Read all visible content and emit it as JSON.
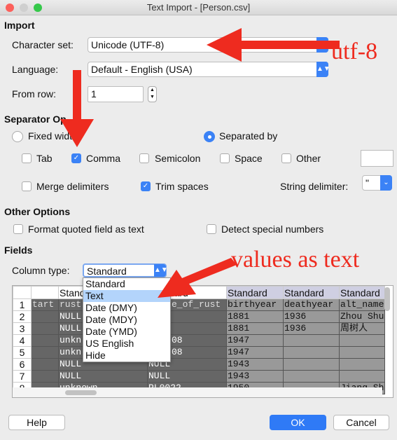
{
  "window": {
    "title": "Text Import - [Person.csv]"
  },
  "import": {
    "heading": "Import",
    "charset_label": "Character set:",
    "charset_value": "Unicode (UTF-8)",
    "language_label": "Language:",
    "language_value": "Default - English (USA)",
    "from_row_label": "From row:",
    "from_row_value": "1"
  },
  "separator": {
    "heading": "Separator Op",
    "fixed_width": "Fixed widt",
    "separated_by": "Separated by",
    "tab": "Tab",
    "comma": "Comma",
    "semicolon": "Semicolon",
    "space": "Space",
    "other": "Other",
    "other_value": "",
    "merge": "Merge delimiters",
    "trim": "Trim spaces",
    "string_delim_label": "String delimiter:",
    "string_delim_value": "\"",
    "checked": {
      "tab": false,
      "comma": true,
      "semicolon": false,
      "space": false,
      "other": false,
      "merge": false,
      "trim": true
    },
    "mode": "separated"
  },
  "other_options": {
    "heading": "Other Options",
    "format_quoted": "Format quoted field as text",
    "detect_special": "Detect special numbers"
  },
  "fields": {
    "heading": "Fields",
    "column_type_label": "Column type:",
    "column_type_value": "Standard",
    "menu": [
      "Standard",
      "Text",
      "Date (DMY)",
      "Date (MDY)",
      "Date (YMD)",
      "US English",
      "Hide"
    ],
    "menu_highlighted": "Text",
    "headers": [
      "",
      "Standard",
      "Standard",
      "Standard",
      "Standard",
      "Standard"
    ],
    "rows": [
      [
        "1",
        "tart",
        "rust",
        "e_of_rust",
        "birthyear",
        "deathyear",
        "alt_name"
      ],
      [
        "2",
        "",
        "NULL",
        "",
        "1881",
        "1936",
        "Zhou Shu"
      ],
      [
        "3",
        "",
        "NULL",
        "",
        "1881",
        "1936",
        "周树人"
      ],
      [
        "4",
        "",
        "unkn",
        "08",
        "1947",
        "",
        ""
      ],
      [
        "5",
        "",
        "unkn",
        "08",
        "1947",
        "",
        ""
      ],
      [
        "6",
        "",
        "NULL",
        "NULL",
        "1943",
        "",
        ""
      ],
      [
        "7",
        "",
        "NULL",
        "NULL",
        "1943",
        "",
        ""
      ],
      [
        "8",
        "",
        "unknown",
        "PL0022",
        "1950",
        "",
        "Jiang Sh"
      ]
    ]
  },
  "buttons": {
    "help": "Help",
    "ok": "OK",
    "cancel": "Cancel"
  },
  "annotations": {
    "utf8": "utf-8",
    "values_as_text": "values as text",
    "color": "#ee2b1f"
  }
}
